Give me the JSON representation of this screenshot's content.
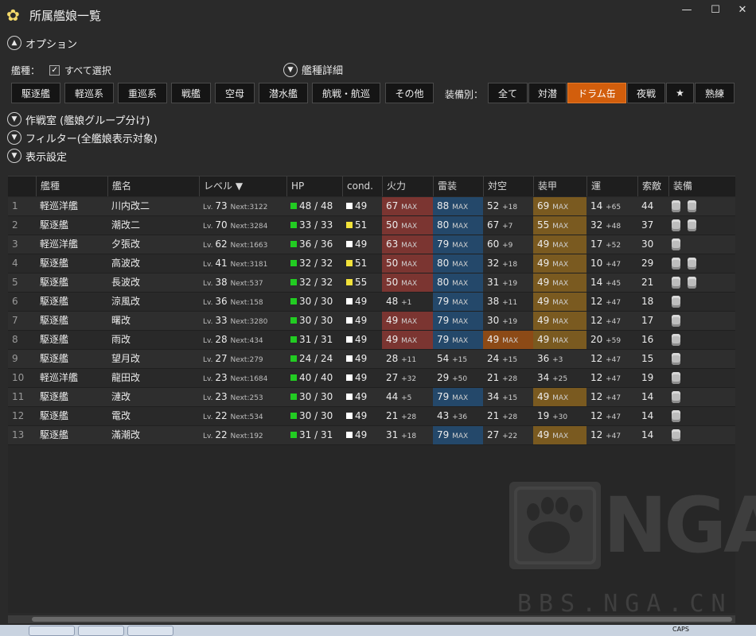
{
  "window": {
    "title": "所属艦娘一覧",
    "icon": "sakura-icon",
    "min": "—",
    "max": "☐",
    "close": "✕"
  },
  "sections": {
    "options": "オプション",
    "strategy": "作戦室 (艦娘グループ分け)",
    "filter": "フィルター(全艦娘表示対象)",
    "display": "表示設定"
  },
  "options": {
    "shiptype_label": "艦種：",
    "select_all": "すべて選択",
    "shiptype_detail": "艦種詳細",
    "equip_label": "装備別："
  },
  "shiptype_buttons": [
    "駆逐艦",
    "軽巡系",
    "重巡系",
    "戦艦",
    "空母",
    "潜水艦",
    "航戦・航巡",
    "その他"
  ],
  "equip_buttons": [
    "全て",
    "対潜",
    "ドラム缶",
    "夜戦",
    "★",
    "熟練"
  ],
  "equip_active": "ドラム缶",
  "table": {
    "headers": [
      "",
      "艦種",
      "艦名",
      "レベル ▼",
      "HP",
      "cond.",
      "火力",
      "雷装",
      "対空",
      "装甲",
      "運",
      "索敵",
      "装備"
    ],
    "rows": [
      {
        "idx": "1",
        "type": "軽巡洋艦",
        "name": "川内改二",
        "lv": "73",
        "next": "Next:3122",
        "hp": "48 / 48",
        "cond": "49",
        "cond_color": "white",
        "fire": "67",
        "fire_s": "MAX",
        "torp": "88",
        "torp_s": "MAX",
        "aa": "52",
        "aa_s": "+18",
        "armor": "69",
        "armor_s": "MAX",
        "luck": "14",
        "luck_s": "+65",
        "los": "44",
        "drums": 2
      },
      {
        "idx": "2",
        "type": "駆逐艦",
        "name": "潮改二",
        "lv": "70",
        "next": "Next:3284",
        "hp": "33 / 33",
        "cond": "51",
        "cond_color": "yellow",
        "fire": "50",
        "fire_s": "MAX",
        "torp": "80",
        "torp_s": "MAX",
        "aa": "67",
        "aa_s": "+7",
        "armor": "55",
        "armor_s": "MAX",
        "luck": "32",
        "luck_s": "+48",
        "los": "37",
        "drums": 2
      },
      {
        "idx": "3",
        "type": "軽巡洋艦",
        "name": "夕張改",
        "lv": "62",
        "next": "Next:1663",
        "hp": "36 / 36",
        "cond": "49",
        "cond_color": "white",
        "fire": "63",
        "fire_s": "MAX",
        "torp": "79",
        "torp_s": "MAX",
        "aa": "60",
        "aa_s": "+9",
        "armor": "49",
        "armor_s": "MAX",
        "luck": "17",
        "luck_s": "+52",
        "los": "30",
        "drums": 1
      },
      {
        "idx": "4",
        "type": "駆逐艦",
        "name": "高波改",
        "lv": "41",
        "next": "Next:3181",
        "hp": "32 / 32",
        "cond": "51",
        "cond_color": "yellow",
        "fire": "50",
        "fire_s": "MAX",
        "torp": "80",
        "torp_s": "MAX",
        "aa": "32",
        "aa_s": "+18",
        "armor": "49",
        "armor_s": "MAX",
        "luck": "10",
        "luck_s": "+47",
        "los": "29",
        "drums": 2
      },
      {
        "idx": "5",
        "type": "駆逐艦",
        "name": "長波改",
        "lv": "38",
        "next": "Next:537",
        "hp": "32 / 32",
        "cond": "55",
        "cond_color": "yellow",
        "fire": "50",
        "fire_s": "MAX",
        "torp": "80",
        "torp_s": "MAX",
        "aa": "31",
        "aa_s": "+19",
        "armor": "49",
        "armor_s": "MAX",
        "luck": "14",
        "luck_s": "+45",
        "los": "21",
        "drums": 2
      },
      {
        "idx": "6",
        "type": "駆逐艦",
        "name": "涼風改",
        "lv": "36",
        "next": "Next:158",
        "hp": "30 / 30",
        "cond": "49",
        "cond_color": "white",
        "fire": "48",
        "fire_s": "+1",
        "torp": "79",
        "torp_s": "MAX",
        "aa": "38",
        "aa_s": "+11",
        "armor": "49",
        "armor_s": "MAX",
        "luck": "12",
        "luck_s": "+47",
        "los": "18",
        "drums": 1
      },
      {
        "idx": "7",
        "type": "駆逐艦",
        "name": "曙改",
        "lv": "33",
        "next": "Next:3280",
        "hp": "30 / 30",
        "cond": "49",
        "cond_color": "white",
        "fire": "49",
        "fire_s": "MAX",
        "torp": "79",
        "torp_s": "MAX",
        "aa": "30",
        "aa_s": "+19",
        "armor": "49",
        "armor_s": "MAX",
        "luck": "12",
        "luck_s": "+47",
        "los": "17",
        "drums": 1
      },
      {
        "idx": "8",
        "type": "駆逐艦",
        "name": "雨改",
        "lv": "28",
        "next": "Next:434",
        "hp": "31 / 31",
        "cond": "49",
        "cond_color": "white",
        "fire": "49",
        "fire_s": "MAX",
        "torp": "79",
        "torp_s": "MAX",
        "aa": "49",
        "aa_s": "MAX",
        "armor": "49",
        "armor_s": "MAX",
        "luck": "20",
        "luck_s": "+59",
        "los": "16",
        "drums": 1
      },
      {
        "idx": "9",
        "type": "駆逐艦",
        "name": "望月改",
        "lv": "27",
        "next": "Next:279",
        "hp": "24 / 24",
        "cond": "49",
        "cond_color": "white",
        "fire": "28",
        "fire_s": "+11",
        "torp": "54",
        "torp_s": "+15",
        "aa": "24",
        "aa_s": "+15",
        "armor": "36",
        "armor_s": "+3",
        "luck": "12",
        "luck_s": "+47",
        "los": "15",
        "drums": 1
      },
      {
        "idx": "10",
        "type": "軽巡洋艦",
        "name": "龍田改",
        "lv": "23",
        "next": "Next:1684",
        "hp": "40 / 40",
        "cond": "49",
        "cond_color": "white",
        "fire": "27",
        "fire_s": "+32",
        "torp": "29",
        "torp_s": "+50",
        "aa": "21",
        "aa_s": "+28",
        "armor": "34",
        "armor_s": "+25",
        "luck": "12",
        "luck_s": "+47",
        "los": "19",
        "drums": 1
      },
      {
        "idx": "11",
        "type": "駆逐艦",
        "name": "漣改",
        "lv": "23",
        "next": "Next:253",
        "hp": "30 / 30",
        "cond": "49",
        "cond_color": "white",
        "fire": "44",
        "fire_s": "+5",
        "torp": "79",
        "torp_s": "MAX",
        "aa": "34",
        "aa_s": "+15",
        "armor": "49",
        "armor_s": "MAX",
        "luck": "12",
        "luck_s": "+47",
        "los": "14",
        "drums": 1
      },
      {
        "idx": "12",
        "type": "駆逐艦",
        "name": "電改",
        "lv": "22",
        "next": "Next:534",
        "hp": "30 / 30",
        "cond": "49",
        "cond_color": "white",
        "fire": "21",
        "fire_s": "+28",
        "torp": "43",
        "torp_s": "+36",
        "aa": "21",
        "aa_s": "+28",
        "armor": "19",
        "armor_s": "+30",
        "luck": "12",
        "luck_s": "+47",
        "los": "14",
        "drums": 1
      },
      {
        "idx": "13",
        "type": "駆逐艦",
        "name": "滿潮改",
        "lv": "22",
        "next": "Next:192",
        "hp": "31 / 31",
        "cond": "49",
        "cond_color": "white",
        "fire": "31",
        "fire_s": "+18",
        "torp": "79",
        "torp_s": "MAX",
        "aa": "27",
        "aa_s": "+22",
        "armor": "49",
        "armor_s": "MAX",
        "luck": "12",
        "luck_s": "+47",
        "los": "14",
        "drums": 1
      }
    ]
  },
  "watermark": {
    "logo": "NGA",
    "url": "BBS.NGA.CN"
  },
  "taskbar": {
    "caps": "CAPS"
  },
  "colors": {
    "accent": "#d25e0c",
    "hp_green": "#22cc22",
    "cond_yellow": "#f2e23a",
    "max_red": "#7b3531",
    "max_blue": "#24486a",
    "max_brown": "#7a5a20",
    "max_orange": "#8c4a16"
  }
}
